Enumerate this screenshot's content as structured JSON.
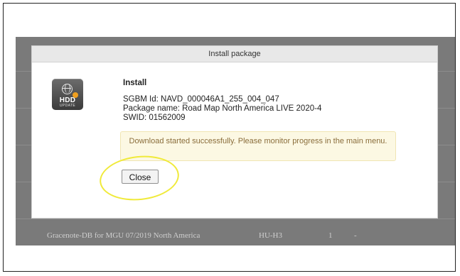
{
  "dialog": {
    "title": "Install package",
    "icon": {
      "name": "hdd-update-icon",
      "label_main": "HDD",
      "label_sub": "UPDATE"
    },
    "heading": "Install",
    "sgbm_id": "SGBM Id: NAVD_000046A1_255_004_047",
    "package_name": "Package name: Road Map North America LIVE 2020-4",
    "swid": "SWID: 01562009",
    "notice": "Download started successfully. Please monitor progress in the main menu.",
    "close_label": "Close"
  },
  "background_row": {
    "name": "Gracenote-DB for MGU 07/2019 North America",
    "unit": "HU-H3",
    "count": "1",
    "status": "-"
  },
  "colors": {
    "overlay": "#7a7a7a",
    "notice_bg": "#fcf8e3",
    "notice_text": "#8a6d3b",
    "highlight": "#f0ea3a"
  }
}
